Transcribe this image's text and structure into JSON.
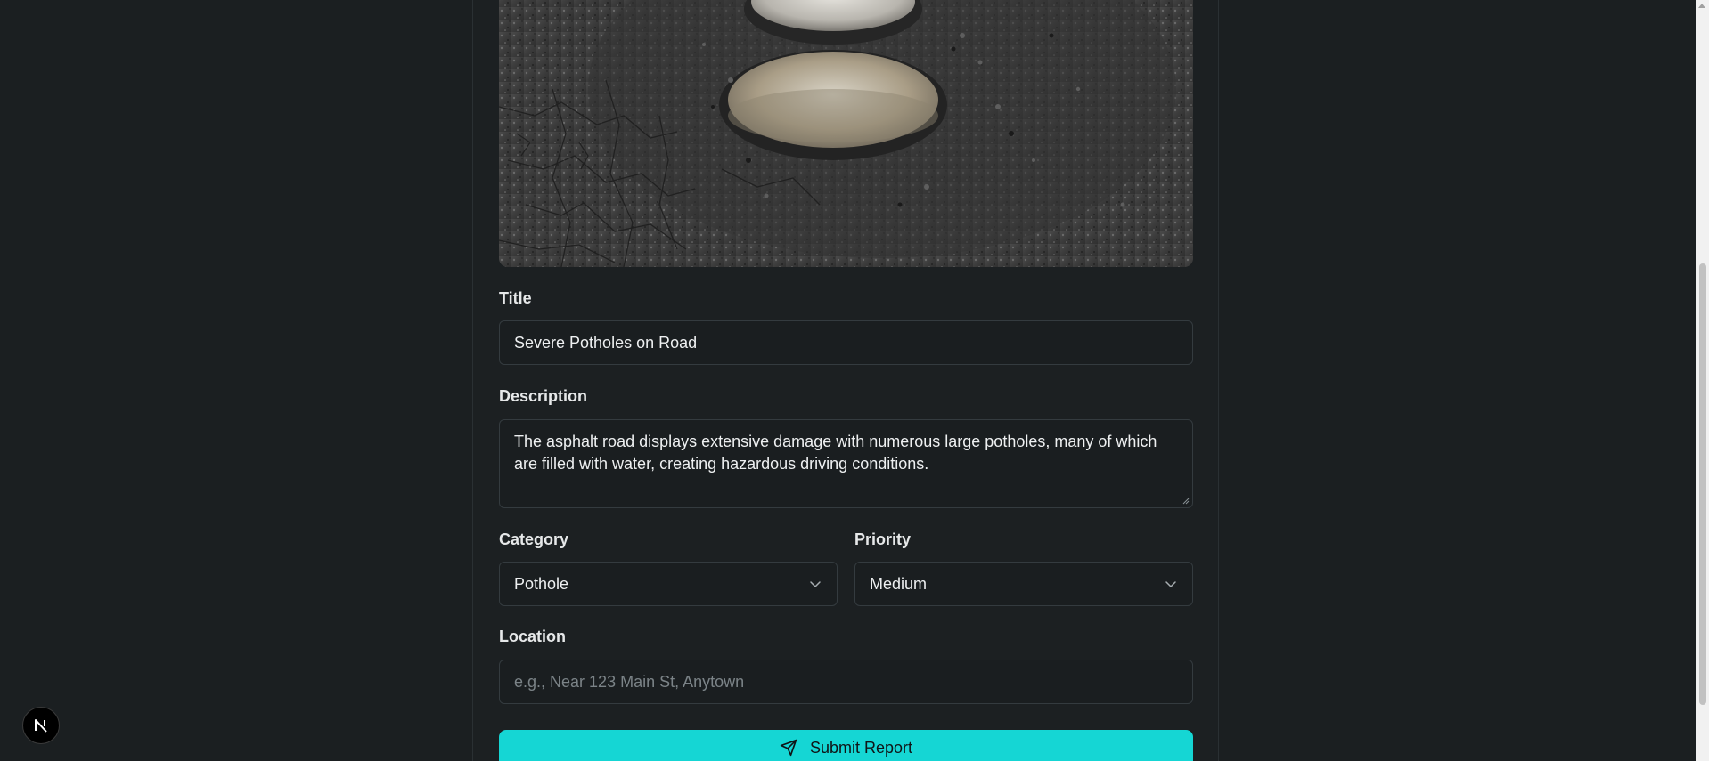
{
  "form": {
    "title_label": "Title",
    "title_value": "Severe Potholes on Road",
    "description_label": "Description",
    "description_value": "The asphalt road displays extensive damage with numerous large potholes, many of which are filled with water, creating hazardous driving conditions.",
    "category_label": "Category",
    "category_value": "Pothole",
    "priority_label": "Priority",
    "priority_value": "Medium",
    "location_label": "Location",
    "location_placeholder": "e.g., Near 123 Main St, Anytown",
    "location_value": "",
    "submit_label": "Submit Report"
  },
  "icons": {
    "submit": "send-icon",
    "select": "chevron-down-icon",
    "framework": "nextjs-logo-icon"
  },
  "colors": {
    "accent": "#15d6d4",
    "background": "#1b1f21",
    "field_background": "#1a1e20"
  }
}
